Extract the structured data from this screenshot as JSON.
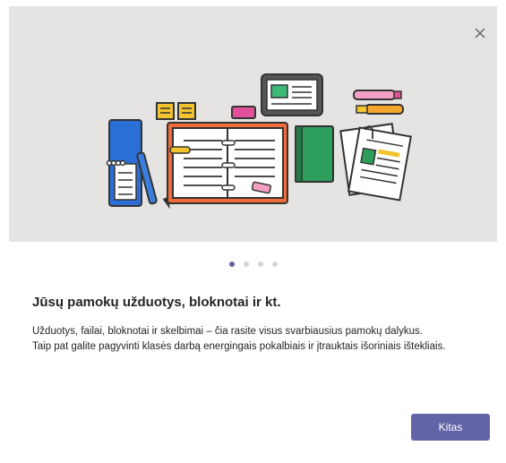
{
  "dialog": {
    "close_icon": "close-icon",
    "carousel": {
      "total_pages": 4,
      "current_page": 1
    },
    "title": "Jūsų pamokų užduotys, bloknotai ir kt.",
    "description_line1": "Užduotys, failai, bloknotai ir skelbimai – čia rasite visus svarbiausius pamokų dalykus.",
    "description_line2": "Taip pat galite pagyvinti klasės darbą energingais pokalbiais ir įtrauktais išoriniais ištekliais.",
    "next_button": "Kitas"
  },
  "colors": {
    "accent": "#6264a7",
    "hero_background": "#e6e4e3",
    "text": "#252423"
  }
}
